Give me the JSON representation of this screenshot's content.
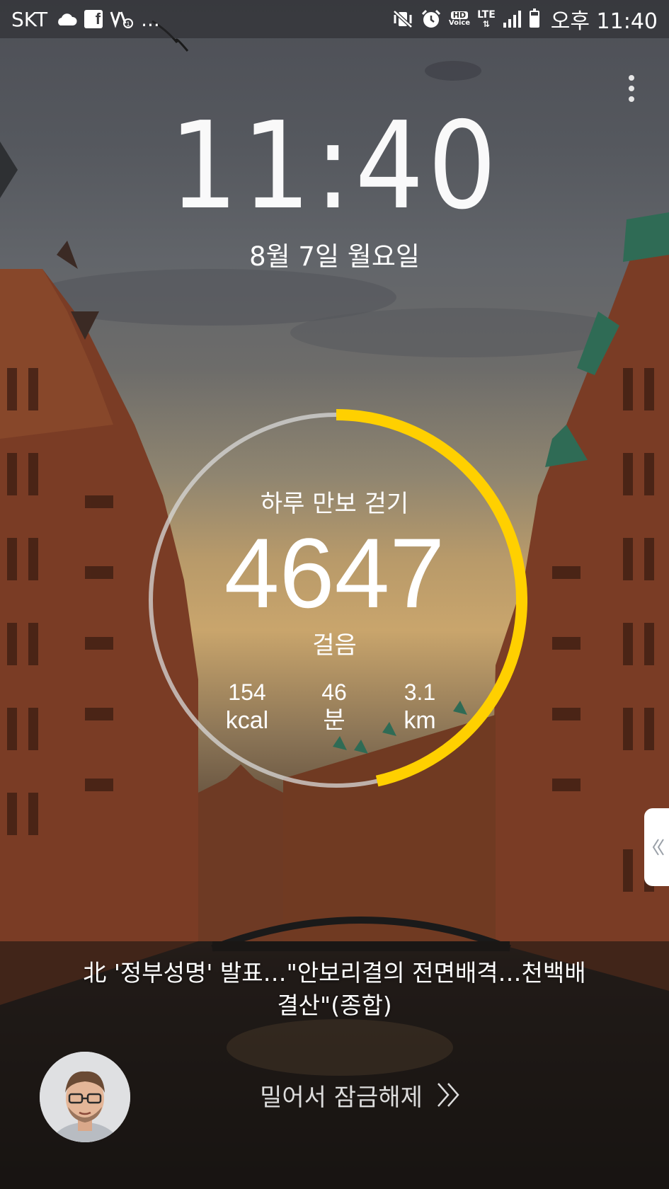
{
  "status_bar": {
    "carrier": "SKT",
    "left_icons": [
      "cloud-icon",
      "facebook-icon",
      "volte-icon",
      "more-notifications-icon"
    ],
    "more_text": "...",
    "right_icons": [
      "mute-vibrate-icon",
      "alarm-icon",
      "hd-voice-icon",
      "lte-icon",
      "signal-icon",
      "battery-icon"
    ],
    "hd_label": "HD",
    "voice_label": "Voice",
    "lte_label": "LTE",
    "battery_level": 0.75,
    "time": "오후 11:40"
  },
  "lockscreen": {
    "clock": "11:40",
    "date": "8월 7일 월요일"
  },
  "step_widget": {
    "title": "하루 만보 걷기",
    "steps": "4647",
    "steps_unit": "걸음",
    "progress": 0.4647,
    "accent_color": "#FFD000",
    "track_color": "#d8d8d8",
    "stats": [
      {
        "value": "154",
        "unit": "kcal"
      },
      {
        "value": "46",
        "unit": "분"
      },
      {
        "value": "3.1",
        "unit": "km"
      }
    ]
  },
  "news": {
    "headline_line1": "北 '정부성명' 발표…\"안보리결의 전면배격…천백배",
    "headline_line2": "결산\"(종합)"
  },
  "unlock": {
    "label": "밀어서 잠금해제"
  },
  "icons": {
    "overflow": "more-vert-icon",
    "side_handle": "chevron-left-double-icon",
    "unlock_arrow": "chevron-right-double-icon"
  }
}
